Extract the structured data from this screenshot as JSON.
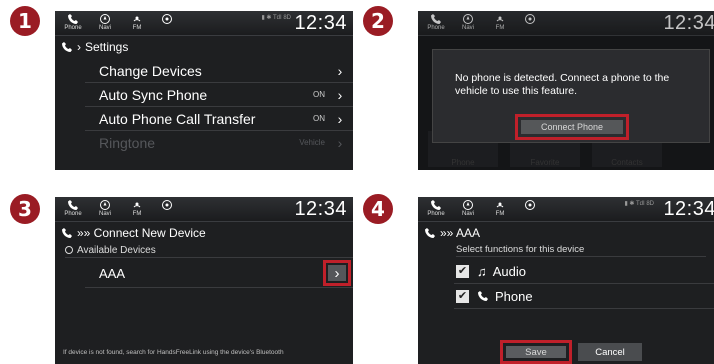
{
  "steps": [
    "1",
    "2",
    "3",
    "4"
  ],
  "nav": {
    "phone": "Phone",
    "navi": "Navi",
    "fm": "FM"
  },
  "clock": "12:34",
  "signal_small": "▮ ✱ TdI 8D",
  "panel1": {
    "breadcrumb": "Settings",
    "rows": [
      {
        "label": "Change Devices",
        "value": "",
        "chevron": "›"
      },
      {
        "label": "Auto Sync Phone",
        "value": "ON",
        "chevron": "›"
      },
      {
        "label": "Auto Phone Call Transfer",
        "value": "ON",
        "chevron": "›"
      },
      {
        "label": "Ringtone",
        "value": "Vehicle",
        "chevron": "›"
      }
    ]
  },
  "panel2": {
    "message": "No phone is detected. Connect a phone to the vehicle to use this feature.",
    "button": "Connect Phone",
    "bg_tiles": [
      "Phone",
      "Favorite",
      "Contacts"
    ]
  },
  "panel3": {
    "breadcrumb": "»» Connect New Device",
    "section": "Available Devices",
    "device": "AAA",
    "chevron": "›",
    "footer": "If device is not found, search for HandsFreeLink using the device's Bluetooth"
  },
  "panel4": {
    "breadcrumb": "»» AAA",
    "subtitle": "Select functions for this device",
    "options": [
      {
        "label": "Audio",
        "checked": true
      },
      {
        "label": "Phone",
        "checked": true
      }
    ],
    "save": "Save",
    "cancel": "Cancel"
  },
  "colors": {
    "accent_red": "#c0202a",
    "badge": "#9a1c24",
    "screen_bg": "#1e1f21"
  }
}
